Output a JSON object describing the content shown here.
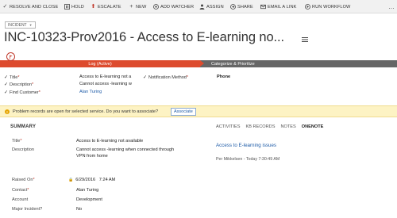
{
  "command_bar": {
    "resolve_close": "RESOLVE AND CLOSE",
    "hold": "HOLD",
    "escalate": "ESCALATE",
    "new": "NEW",
    "add_watcher": "ADD WATCHER",
    "assign": "ASSIGN",
    "share": "SHARE",
    "email_link": "EMAIL A LINK",
    "run_workflow": "RUN WORKFLOW",
    "more": "…"
  },
  "header": {
    "entity_badge": "INCIDENT",
    "title": "INC-10323-Prov2016 - Access to E-learning no...",
    "menu_icon": "list-menu-icon"
  },
  "process": {
    "flag_icon": "flag-icon",
    "active_stage": "Log (Active)",
    "next_stage": "Categorize & Prioritize",
    "active_color": "#dd4b2e"
  },
  "stage_fields": {
    "title_label": "Title",
    "title_value": "Access to E-learning not a",
    "description_label": "Description",
    "description_value": "Cannot access -learning w",
    "find_customer_label": "Find Customer",
    "find_customer_value": "Alan Turing",
    "notification_method_label": "Notification Method",
    "notification_method_value": "Phone",
    "required_mark": "*"
  },
  "notification": {
    "icon": "info-icon",
    "text": "Problem records are open for selected service. Do you want to associate?",
    "button": "Associate"
  },
  "summary": {
    "heading": "SUMMARY",
    "title_label": "Title",
    "title_value": "Access to E-learning not available",
    "description_label": "Description",
    "description_line1": "Cannot access -learning when connected through",
    "description_line2": "VPN from home",
    "raised_on_label": "Raised On",
    "raised_on_date": "6/29/2016",
    "raised_on_time": "7:24 AM",
    "contact_label": "Contact",
    "contact_value": "Alan Turing",
    "account_label": "Account",
    "account_value": "Development",
    "major_incident_label": "Major Incident?",
    "major_incident_value": "No"
  },
  "activity": {
    "tabs": [
      "ACTIVITIES",
      "KB RECORDS",
      "NOTES",
      "ONENOTE"
    ],
    "active_tab": "ONENOTE",
    "note_title": "Access to E-learning issues",
    "note_meta": "Per Mikkelsen - Today 7:30:49 AM"
  }
}
